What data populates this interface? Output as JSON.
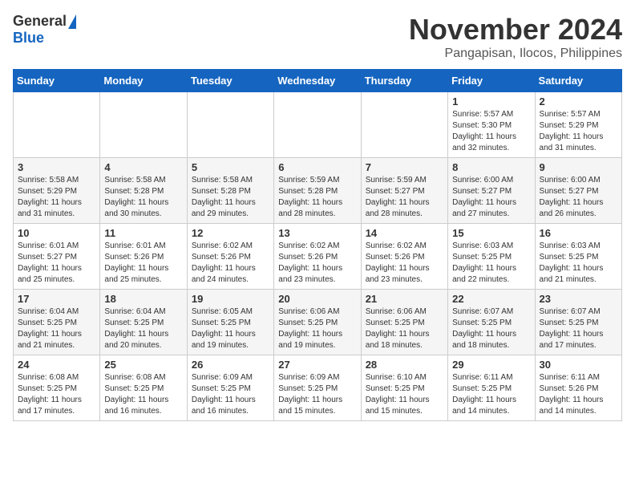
{
  "header": {
    "logo_general": "General",
    "logo_blue": "Blue",
    "month": "November 2024",
    "location": "Pangapisan, Ilocos, Philippines"
  },
  "days_of_week": [
    "Sunday",
    "Monday",
    "Tuesday",
    "Wednesday",
    "Thursday",
    "Friday",
    "Saturday"
  ],
  "weeks": [
    [
      {
        "day": "",
        "info": ""
      },
      {
        "day": "",
        "info": ""
      },
      {
        "day": "",
        "info": ""
      },
      {
        "day": "",
        "info": ""
      },
      {
        "day": "",
        "info": ""
      },
      {
        "day": "1",
        "info": "Sunrise: 5:57 AM\nSunset: 5:30 PM\nDaylight: 11 hours and 32 minutes."
      },
      {
        "day": "2",
        "info": "Sunrise: 5:57 AM\nSunset: 5:29 PM\nDaylight: 11 hours and 31 minutes."
      }
    ],
    [
      {
        "day": "3",
        "info": "Sunrise: 5:58 AM\nSunset: 5:29 PM\nDaylight: 11 hours and 31 minutes."
      },
      {
        "day": "4",
        "info": "Sunrise: 5:58 AM\nSunset: 5:28 PM\nDaylight: 11 hours and 30 minutes."
      },
      {
        "day": "5",
        "info": "Sunrise: 5:58 AM\nSunset: 5:28 PM\nDaylight: 11 hours and 29 minutes."
      },
      {
        "day": "6",
        "info": "Sunrise: 5:59 AM\nSunset: 5:28 PM\nDaylight: 11 hours and 28 minutes."
      },
      {
        "day": "7",
        "info": "Sunrise: 5:59 AM\nSunset: 5:27 PM\nDaylight: 11 hours and 28 minutes."
      },
      {
        "day": "8",
        "info": "Sunrise: 6:00 AM\nSunset: 5:27 PM\nDaylight: 11 hours and 27 minutes."
      },
      {
        "day": "9",
        "info": "Sunrise: 6:00 AM\nSunset: 5:27 PM\nDaylight: 11 hours and 26 minutes."
      }
    ],
    [
      {
        "day": "10",
        "info": "Sunrise: 6:01 AM\nSunset: 5:27 PM\nDaylight: 11 hours and 25 minutes."
      },
      {
        "day": "11",
        "info": "Sunrise: 6:01 AM\nSunset: 5:26 PM\nDaylight: 11 hours and 25 minutes."
      },
      {
        "day": "12",
        "info": "Sunrise: 6:02 AM\nSunset: 5:26 PM\nDaylight: 11 hours and 24 minutes."
      },
      {
        "day": "13",
        "info": "Sunrise: 6:02 AM\nSunset: 5:26 PM\nDaylight: 11 hours and 23 minutes."
      },
      {
        "day": "14",
        "info": "Sunrise: 6:02 AM\nSunset: 5:26 PM\nDaylight: 11 hours and 23 minutes."
      },
      {
        "day": "15",
        "info": "Sunrise: 6:03 AM\nSunset: 5:25 PM\nDaylight: 11 hours and 22 minutes."
      },
      {
        "day": "16",
        "info": "Sunrise: 6:03 AM\nSunset: 5:25 PM\nDaylight: 11 hours and 21 minutes."
      }
    ],
    [
      {
        "day": "17",
        "info": "Sunrise: 6:04 AM\nSunset: 5:25 PM\nDaylight: 11 hours and 21 minutes."
      },
      {
        "day": "18",
        "info": "Sunrise: 6:04 AM\nSunset: 5:25 PM\nDaylight: 11 hours and 20 minutes."
      },
      {
        "day": "19",
        "info": "Sunrise: 6:05 AM\nSunset: 5:25 PM\nDaylight: 11 hours and 19 minutes."
      },
      {
        "day": "20",
        "info": "Sunrise: 6:06 AM\nSunset: 5:25 PM\nDaylight: 11 hours and 19 minutes."
      },
      {
        "day": "21",
        "info": "Sunrise: 6:06 AM\nSunset: 5:25 PM\nDaylight: 11 hours and 18 minutes."
      },
      {
        "day": "22",
        "info": "Sunrise: 6:07 AM\nSunset: 5:25 PM\nDaylight: 11 hours and 18 minutes."
      },
      {
        "day": "23",
        "info": "Sunrise: 6:07 AM\nSunset: 5:25 PM\nDaylight: 11 hours and 17 minutes."
      }
    ],
    [
      {
        "day": "24",
        "info": "Sunrise: 6:08 AM\nSunset: 5:25 PM\nDaylight: 11 hours and 17 minutes."
      },
      {
        "day": "25",
        "info": "Sunrise: 6:08 AM\nSunset: 5:25 PM\nDaylight: 11 hours and 16 minutes."
      },
      {
        "day": "26",
        "info": "Sunrise: 6:09 AM\nSunset: 5:25 PM\nDaylight: 11 hours and 16 minutes."
      },
      {
        "day": "27",
        "info": "Sunrise: 6:09 AM\nSunset: 5:25 PM\nDaylight: 11 hours and 15 minutes."
      },
      {
        "day": "28",
        "info": "Sunrise: 6:10 AM\nSunset: 5:25 PM\nDaylight: 11 hours and 15 minutes."
      },
      {
        "day": "29",
        "info": "Sunrise: 6:11 AM\nSunset: 5:25 PM\nDaylight: 11 hours and 14 minutes."
      },
      {
        "day": "30",
        "info": "Sunrise: 6:11 AM\nSunset: 5:26 PM\nDaylight: 11 hours and 14 minutes."
      }
    ]
  ]
}
